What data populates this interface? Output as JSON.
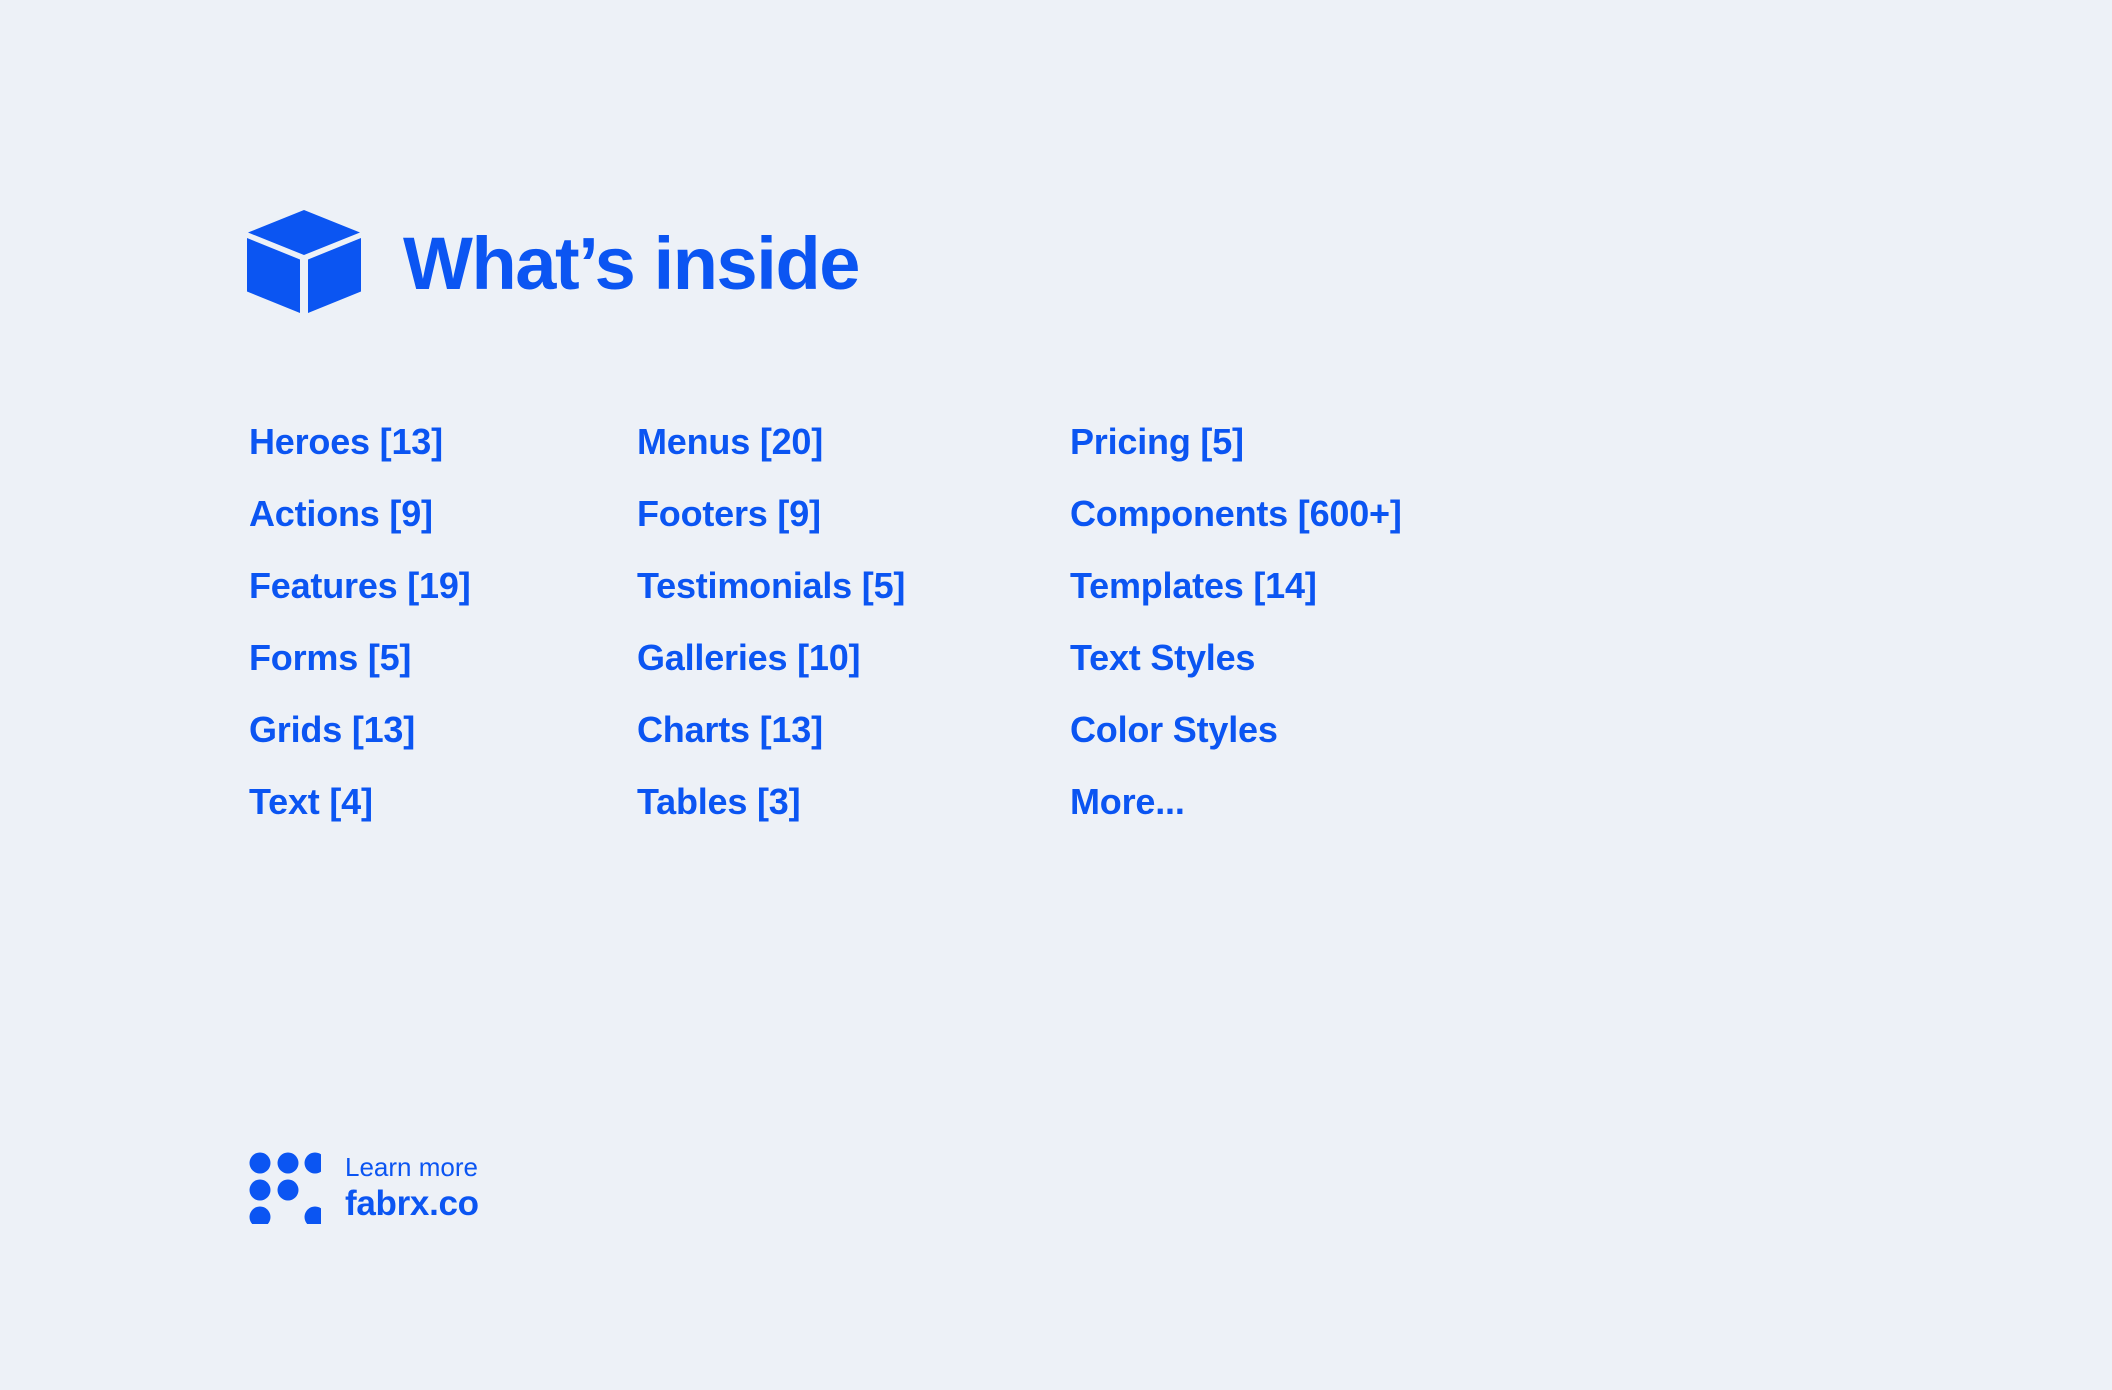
{
  "theme": {
    "background_color": "#EDF1F7",
    "brand_color": "#0B55F2"
  },
  "header": {
    "logo_icon": "cube-icon",
    "title": "What’s inside"
  },
  "content": {
    "columns": [
      {
        "items": [
          {
            "label": "Heroes [13]"
          },
          {
            "label": "Actions [9]"
          },
          {
            "label": "Features [19]"
          },
          {
            "label": "Forms [5]"
          },
          {
            "label": "Grids [13]"
          },
          {
            "label": "Text [4]"
          }
        ]
      },
      {
        "items": [
          {
            "label": "Menus [20]"
          },
          {
            "label": "Footers [9]"
          },
          {
            "label": "Testimonials [5]"
          },
          {
            "label": "Galleries [10]"
          },
          {
            "label": "Charts [13]"
          },
          {
            "label": "Tables [3]"
          }
        ]
      },
      {
        "items": [
          {
            "label": "Pricing [5]"
          },
          {
            "label": "Components [600+]"
          },
          {
            "label": "Templates [14]"
          },
          {
            "label": "Text Styles"
          },
          {
            "label": "Color Styles"
          },
          {
            "label": "More..."
          }
        ]
      }
    ]
  },
  "footer": {
    "logo_icon": "dot-grid-icon",
    "learn_more": "Learn more",
    "domain": "fabrx.co"
  }
}
